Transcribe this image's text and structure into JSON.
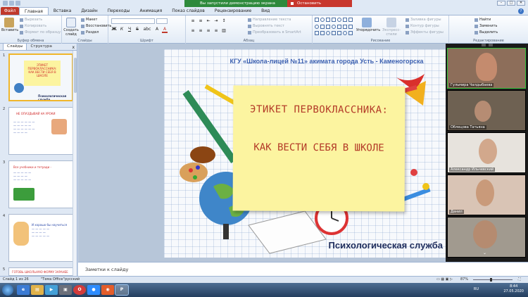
{
  "window": {
    "sharing_message": "Вы запустили демонстрацию экрана",
    "stop_sharing": "Остановить демонстрацию",
    "controls": [
      "–",
      "□",
      "✕"
    ]
  },
  "ribbon_tabs": {
    "file": "Файл",
    "tabs": [
      "Главная",
      "Вставка",
      "Дизайн",
      "Переходы",
      "Анимация",
      "Показ слайдов",
      "Рецензирование",
      "Вид"
    ],
    "active": "Главная"
  },
  "ribbon": {
    "clipboard": {
      "paste": "Вставить",
      "cut": "Вырезать",
      "copy": "Копировать",
      "format_painter": "Формат по образцу",
      "label": "Буфер обмена"
    },
    "slides": {
      "new_slide": "Создать слайд",
      "layout": "Макет",
      "reset": "Восстановить",
      "section": "Раздел",
      "label": "Слайды"
    },
    "font": {
      "bold": "Ж",
      "italic": "К",
      "underline": "Ч",
      "strike": "S",
      "shadow": "abc",
      "size_up": "A",
      "color": "A",
      "label": "Шрифт"
    },
    "paragraph": {
      "direction": "Направление текста",
      "align": "Выровнять текст",
      "smartart": "Преобразовать в SmartArt",
      "label": "Абзац"
    },
    "drawing": {
      "arrange": "Упорядочить",
      "quick_styles": "Экспресс-стили",
      "fill": "Заливка фигуры",
      "outline": "Контур фигуры",
      "effects": "Эффекты фигуры",
      "label": "Рисование"
    },
    "editing": {
      "find": "Найти",
      "replace": "Заменить",
      "select": "Выделить",
      "label": "Редактирование"
    }
  },
  "left_panel": {
    "tabs": [
      "Слайды",
      "Структура"
    ],
    "close": "x",
    "thumbnails": [
      {
        "num": "1",
        "title": "ЭТИКЕТ ПЕРВОКЛАССНИКА: КАК ВЕСТИ СЕБЯ В ШКОЛЕ",
        "foot": "Психологическая служба"
      },
      {
        "num": "2",
        "title": "НЕ ОПАЗДЫВАЙ НА УРОКИ"
      },
      {
        "num": "3",
        "title": "Все учебники и тетради -"
      },
      {
        "num": "4",
        "title": "И хорошо бы научиться"
      },
      {
        "num": "5",
        "title": "ГОТОВЬ ШКОЛЬНУЮ ФОРМУ ЗАРАНЕЕ"
      }
    ]
  },
  "slide": {
    "header": "КГУ «Школа-лицей №11» акимата города  Усть - Каменогорска",
    "title": "ЭТИКЕТ ПЕРВОКЛАССНИКА:",
    "subtitle": "КАК ВЕСТИ СЕБЯ В ШКОЛЕ",
    "service": "Психологическая служба"
  },
  "zoom": {
    "participants": [
      {
        "name": "Гульмира Чалдыбаева"
      },
      {
        "name": "Облецова Татьяна"
      },
      {
        "name": "Александр Ильчевский"
      },
      {
        "name": "Данил"
      },
      {
        "name": ""
      }
    ]
  },
  "notes": {
    "placeholder": "Заметки к слайду"
  },
  "status": {
    "slide": "Слайд 1 из 26",
    "theme": "\"Тема Office\"",
    "lang": "русский",
    "zoom": "87%"
  },
  "taskbar": {
    "lang": "RU",
    "time": "8:44",
    "date": "27.05.2020"
  },
  "colors": {
    "accent_red": "#c0392b",
    "zoom_bg": "#1a1a1a",
    "share_green": "#2d8a3c"
  }
}
